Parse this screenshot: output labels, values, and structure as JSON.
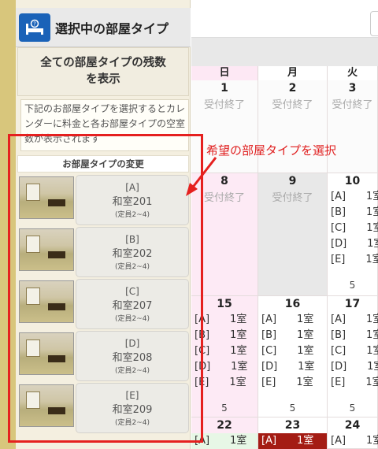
{
  "sidebar": {
    "title": "選択中の部屋タイプ",
    "show_all": "全ての部屋タイプの残数\nを表示",
    "description": "下記のお部屋タイプを選択するとカレンダーに料金と各お部屋タイプの空室数が表示されます",
    "change_label": "お部屋タイプの変更",
    "rooms": [
      {
        "code": "[A]",
        "name": "和室201",
        "capacity": "(定員2~4)"
      },
      {
        "code": "[B]",
        "name": "和室202",
        "capacity": "(定員2~4)"
      },
      {
        "code": "[C]",
        "name": "和室207",
        "capacity": "(定員2~4)"
      },
      {
        "code": "[D]",
        "name": "和室208",
        "capacity": "(定員2~4)"
      },
      {
        "code": "[E]",
        "name": "和室209",
        "capacity": "(定員2~4)"
      }
    ]
  },
  "calendar": {
    "weekdays": [
      "日",
      "月",
      "火"
    ],
    "closed_label": "受付終了",
    "rows": [
      {
        "dates": [
          "1",
          "2",
          "3"
        ]
      },
      {
        "dates": [
          "8",
          "9",
          "10"
        ]
      },
      {
        "dates": [
          "15",
          "16",
          "17"
        ]
      },
      {
        "dates": [
          "22",
          "23",
          "24"
        ]
      }
    ],
    "availability": [
      "[A]　　1室",
      "[B]　　1室",
      "[C]　　1室",
      "[D]　　1室",
      "[E]　　1室"
    ],
    "availability_partial": [
      "[A]　　1室",
      "[B]　　1室",
      "[C]　　1室",
      "[D]　　1室",
      "[E]　　1室"
    ],
    "row4_first": "[A]　　1室",
    "total": "5"
  },
  "annotation": {
    "text": "希望の部屋タイプを選択"
  },
  "colors": {
    "accent": "#1a62b8",
    "annotation": "#e5201f",
    "sunday": "#fde8f4",
    "selected": "#a41c14"
  }
}
